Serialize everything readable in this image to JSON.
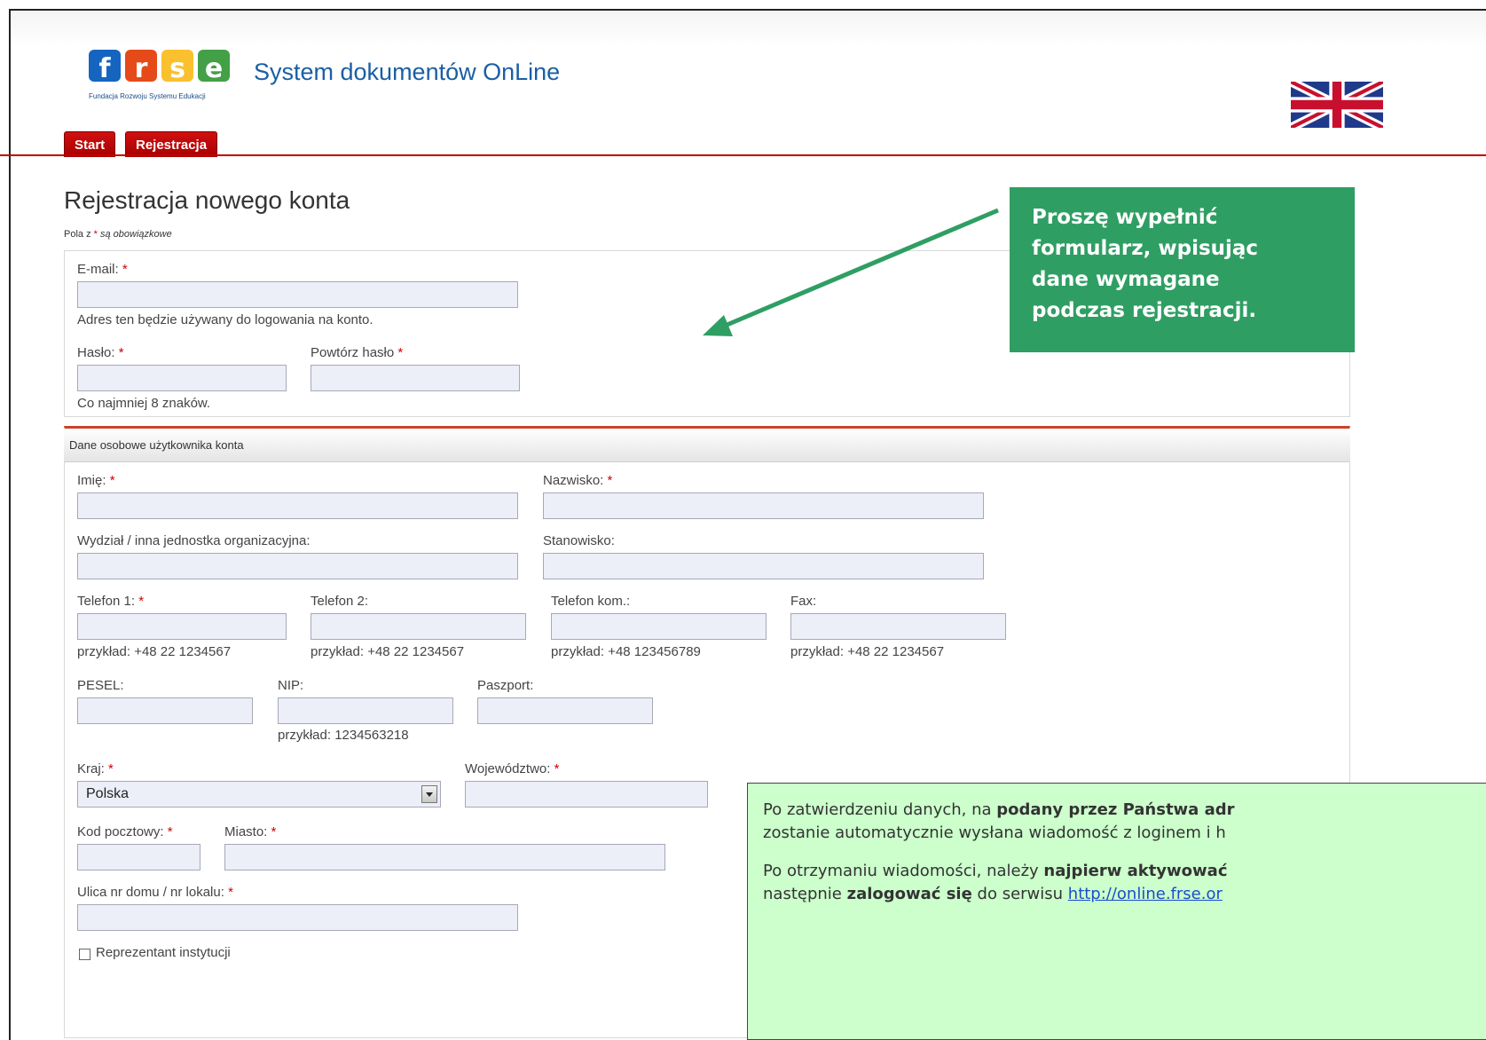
{
  "header": {
    "logo_text": "frse",
    "logo_subtitle": "Fundacja Rozwoju Systemu Edukacji",
    "app_title": "System dokumentów OnLine",
    "language_flag": "uk-flag-icon"
  },
  "tabs": [
    {
      "label": "Start"
    },
    {
      "label": "Rejestracja"
    }
  ],
  "page": {
    "title": "Rejestracja nowego konta",
    "required_note_prefix": "Pola z",
    "required_note_suffix": "są obowiązkowe",
    "required_mark": "*"
  },
  "account": {
    "email_label": "E-mail:",
    "email_value": "",
    "email_hint": "Adres ten będzie używany do logowania na konto.",
    "password_label": "Hasło:",
    "password_repeat_label": "Powtórz hasło",
    "password_hint": "Co najmniej 8 znaków."
  },
  "personal": {
    "section_title": "Dane osobowe użytkownika konta",
    "first_name_label": "Imię:",
    "last_name_label": "Nazwisko:",
    "department_label": "Wydział / inna jednostka organizacyjna:",
    "position_label": "Stanowisko:",
    "phone1_label": "Telefon 1:",
    "phone2_label": "Telefon 2:",
    "mobile_label": "Telefon kom.:",
    "fax_label": "Fax:",
    "phone1_hint": "przykład: +48 22 1234567",
    "phone2_hint": "przykład: +48 22 1234567",
    "mobile_hint": "przykład: +48 123456789",
    "fax_hint": "przykład: +48 22 1234567",
    "pesel_label": "PESEL:",
    "nip_label": "NIP:",
    "passport_label": "Paszport:",
    "nip_hint": "przykład: 1234563218",
    "country_label": "Kraj:",
    "country_value": "Polska",
    "voivodeship_label": "Województwo:",
    "postal_label": "Kod pocztowy:",
    "city_label": "Miasto:",
    "street_label": "Ulica nr domu / nr lokalu:",
    "representative_label": "Reprezentant instytucji"
  },
  "callout": {
    "lines": [
      "Proszę wypełnić",
      "formularz, wpisując",
      "dane wymagane",
      "podczas rejestracji."
    ],
    "color": "#2f9e63"
  },
  "info_box": {
    "p1_a": "Po zatwierdzeniu danych, na ",
    "p1_b": "podany przez Państwa adr",
    "p2": "zostanie automatycznie wysłana wiadomość z loginem i h",
    "p3_a": "Po otrzymaniu wiadomości, należy ",
    "p3_b": "najpierw aktywować",
    "p4_a": "następnie ",
    "p4_b": "zalogować się",
    "p4_c": " do serwisu ",
    "p4_link": "http://online.frse.or",
    "background": "#ccffcc"
  },
  "colors": {
    "tab_red": "#c00000",
    "title_blue": "#1a5fa4",
    "input_bg": "#eceef8"
  }
}
